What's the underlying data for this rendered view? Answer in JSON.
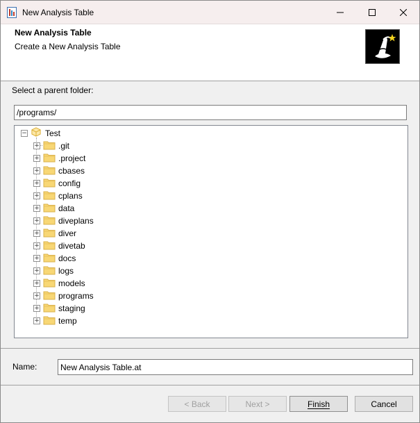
{
  "window": {
    "title": "New Analysis Table",
    "controls": {
      "minimize": "minimize",
      "maximize": "maximize",
      "close": "close"
    }
  },
  "header": {
    "title": "New Analysis Table",
    "subtitle": "Create a New Analysis Table",
    "logo_icon": "wizard-hat-icon"
  },
  "parent_folder": {
    "label": "Select a parent folder:",
    "value": "/programs/"
  },
  "tree": {
    "root": {
      "label": "Test",
      "icon": "project-cube-icon",
      "expanded": true
    },
    "items": [
      {
        "label": ".git"
      },
      {
        "label": ".project"
      },
      {
        "label": "cbases"
      },
      {
        "label": "config"
      },
      {
        "label": "cplans"
      },
      {
        "label": "data"
      },
      {
        "label": "diveplans"
      },
      {
        "label": "diver"
      },
      {
        "label": "divetab"
      },
      {
        "label": "docs"
      },
      {
        "label": "logs"
      },
      {
        "label": "models"
      },
      {
        "label": "programs"
      },
      {
        "label": "staging"
      },
      {
        "label": "temp"
      }
    ]
  },
  "name_field": {
    "label": "Name:",
    "value": "New Analysis Table.at"
  },
  "buttons": {
    "back": "< Back",
    "next": "Next >",
    "finish": "Finish",
    "cancel": "Cancel"
  }
}
